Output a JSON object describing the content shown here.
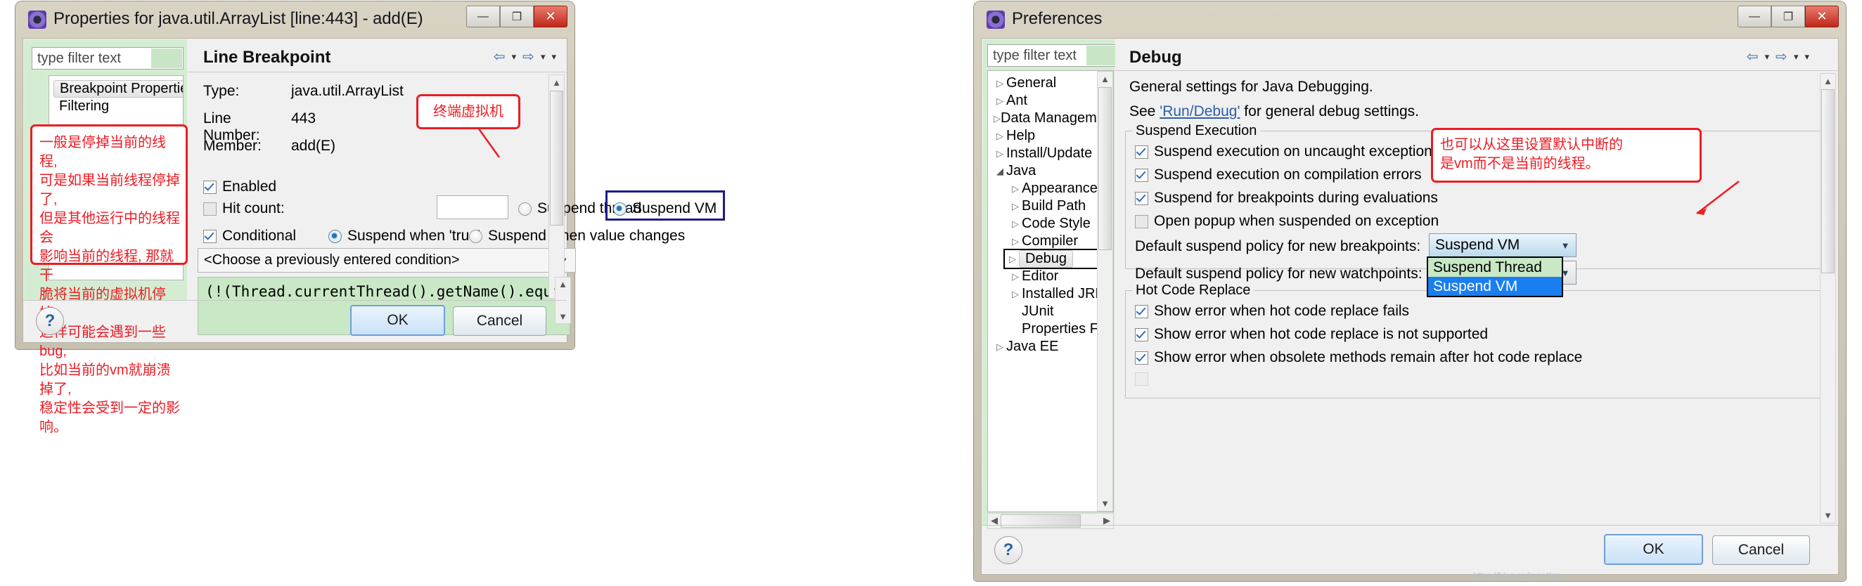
{
  "properties_dialog": {
    "title": "Properties for java.util.ArrayList [line:443] - add(E)",
    "window_buttons": {
      "minimize": "—",
      "maximize": "❐",
      "close": "✕"
    },
    "filter_placeholder": "type filter text",
    "tree": [
      {
        "label": "Breakpoint Properties",
        "selected": true
      },
      {
        "label": "Filtering",
        "selected": false
      }
    ],
    "annotation_left": [
      "一般是停掉当前的线程,",
      "可是如果当前线程停掉了,",
      "但是其他运行中的线程会",
      "影响当前的线程, 那就干",
      "脆将当前的虚拟机停掉,",
      "这样可能会遇到一些bug,",
      "比如当前的vm就崩溃掉了,",
      "稳定性会受到一定的影响。"
    ],
    "annotation_vm": "终端虚拟机",
    "pane": {
      "heading": "Line Breakpoint",
      "nav": {
        "back": "⇦",
        "back_menu": "▾",
        "forward": "⇨",
        "forward_menu": "▾",
        "view_menu": "▾"
      },
      "fields": [
        {
          "label": "Type:",
          "value": "java.util.ArrayList"
        },
        {
          "label": "Line Number:",
          "value": "443"
        },
        {
          "label": "Member:",
          "value": "add(E)"
        }
      ],
      "enabled": {
        "label": "Enabled",
        "checked": true
      },
      "hit_count": {
        "label": "Hit count:",
        "checked": false,
        "value": ""
      },
      "suspend_thread": {
        "label": "Suspend thread",
        "selected": false
      },
      "suspend_vm": {
        "label": "Suspend VM",
        "selected": true
      },
      "conditional": {
        "label": "Conditional",
        "checked": true
      },
      "suspend_when_true": {
        "label": "Suspend when 'true'",
        "selected": true
      },
      "suspend_when_change": {
        "label": "Suspend when value changes",
        "selected": false
      },
      "condition_combo": "<Choose a previously entered condition>",
      "condition_code": "(!(Thread.currentThread().getName().equals(\"main\")"
    },
    "buttons": {
      "ok": "OK",
      "cancel": "Cancel",
      "help": "?"
    }
  },
  "preferences_dialog": {
    "title": "Preferences",
    "window_buttons": {
      "minimize": "—",
      "maximize": "❐",
      "close": "✕"
    },
    "filter_placeholder": "type filter text",
    "tree": [
      {
        "label": "General",
        "indent": 0,
        "state": "collapsed"
      },
      {
        "label": "Ant",
        "indent": 0,
        "state": "collapsed"
      },
      {
        "label": "Data Management",
        "indent": 0,
        "state": "collapsed"
      },
      {
        "label": "Help",
        "indent": 0,
        "state": "collapsed"
      },
      {
        "label": "Install/Update",
        "indent": 0,
        "state": "collapsed"
      },
      {
        "label": "Java",
        "indent": 0,
        "state": "expanded"
      },
      {
        "label": "Appearance",
        "indent": 1,
        "state": "collapsed"
      },
      {
        "label": "Build Path",
        "indent": 1,
        "state": "collapsed"
      },
      {
        "label": "Code Style",
        "indent": 1,
        "state": "collapsed"
      },
      {
        "label": "Compiler",
        "indent": 1,
        "state": "collapsed"
      },
      {
        "label": "Debug",
        "indent": 1,
        "state": "collapsed",
        "selected": true
      },
      {
        "label": "Editor",
        "indent": 1,
        "state": "collapsed"
      },
      {
        "label": "Installed JREs",
        "indent": 1,
        "state": "collapsed"
      },
      {
        "label": "JUnit",
        "indent": 1,
        "state": "leaf"
      },
      {
        "label": "Properties Files Ed",
        "indent": 1,
        "state": "leaf"
      },
      {
        "label": "Java EE",
        "indent": 0,
        "state": "collapsed"
      }
    ],
    "pane": {
      "heading": "Debug",
      "nav": {
        "back": "⇦",
        "back_menu": "▾",
        "forward": "⇨",
        "forward_menu": "▾",
        "view_menu": "▾"
      },
      "intro": "General settings for Java Debugging.",
      "see_prefix": "See ",
      "see_link": "'Run/Debug'",
      "see_suffix": " for general debug settings.",
      "suspend_group": {
        "title": "Suspend Execution",
        "items": [
          {
            "label": "Suspend execution on uncaught exceptions",
            "checked": true
          },
          {
            "label": "Suspend execution on compilation errors",
            "checked": true
          },
          {
            "label": "Suspend for breakpoints during evaluations",
            "checked": true
          },
          {
            "label": "Open popup when suspended on exception",
            "checked": false
          }
        ],
        "breakpoints_label": "Default suspend policy for new breakpoints:",
        "breakpoints_value": "Suspend VM",
        "watchpoints_label": "Default suspend policy for new watchpoints:",
        "dropdown_options": [
          {
            "label": "Suspend Thread",
            "highlighted": false
          },
          {
            "label": "Suspend VM",
            "highlighted": true
          }
        ]
      },
      "hot_code_group": {
        "title": "Hot Code Replace",
        "items": [
          {
            "label": "Show error when hot code replace fails",
            "checked": true
          },
          {
            "label": "Show error when hot code replace is not supported",
            "checked": true
          },
          {
            "label": "Show error when obsolete methods remain after hot code replace",
            "checked": true
          }
        ]
      }
    },
    "annotation_right": [
      "也可以从这里设置默认中断的",
      "是vm而不是当前的线程。"
    ],
    "buttons": {
      "ok": "OK",
      "cancel": "Cancel",
      "help": "?"
    }
  },
  "watermark": "https://blog.csdn.net/qq..."
}
